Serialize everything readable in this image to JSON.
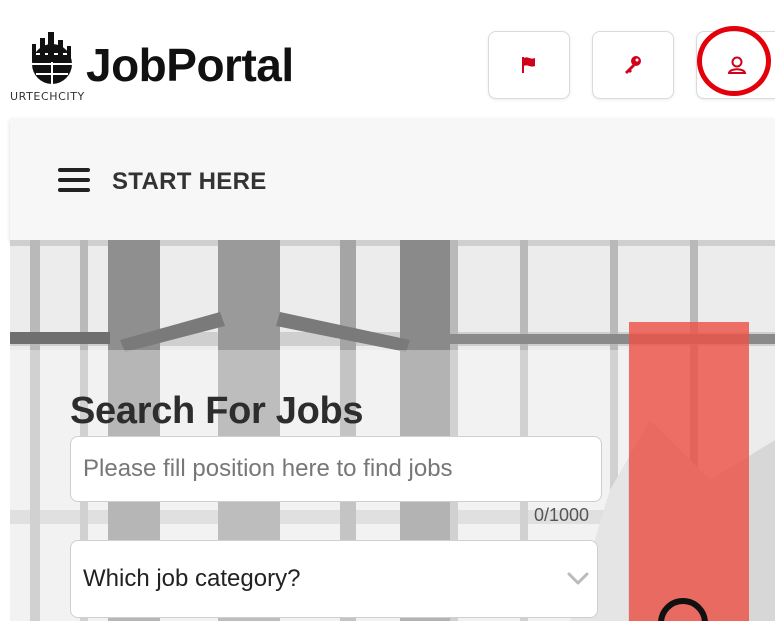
{
  "brand": {
    "title": "JobPortal",
    "subtitle": "URTECHCITY"
  },
  "header": {
    "buttons": [
      {
        "icon": "flag-icon",
        "color": "#d0021b"
      },
      {
        "icon": "key-icon",
        "color": "#d0021b"
      },
      {
        "icon": "user-icon",
        "color": "#d0021b",
        "highlighted": true
      }
    ],
    "highlight_color": "#e4000b"
  },
  "nav": {
    "menu_icon": "hamburger-menu-icon",
    "label": "START HERE"
  },
  "search": {
    "title": "Search For Jobs",
    "position_placeholder": "Please fill position here to find jobs",
    "position_value": "",
    "char_counter": "0/1000",
    "category_label": "Which job category?",
    "category_icon": "chevron-down-icon"
  },
  "colors": {
    "accent_red": "#d0021b",
    "overlay_red": "#ec5247",
    "navbar_bg": "#f7f7f7"
  }
}
